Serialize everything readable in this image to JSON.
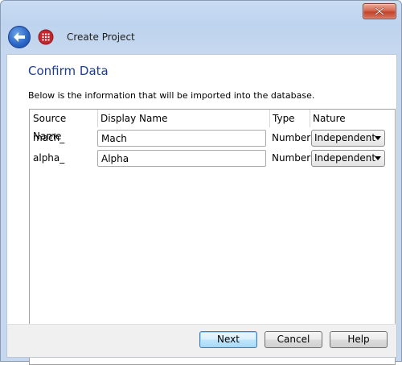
{
  "window": {
    "title": "Create Project"
  },
  "page": {
    "heading": "Confirm Data",
    "description": "Below is the information that will be imported into the database."
  },
  "table": {
    "columns": [
      "Source Name",
      "Display Name",
      "Type",
      "Nature"
    ],
    "rows": [
      {
        "source_name": "mach_",
        "display_name": "Mach",
        "type": "Number",
        "nature": "Independent"
      },
      {
        "source_name": "alpha_",
        "display_name": "Alpha",
        "type": "Number",
        "nature": "Independent"
      }
    ]
  },
  "buttons": {
    "next": "Next",
    "cancel": "Cancel",
    "help": "Help"
  },
  "colors": {
    "heading": "#1f3e8f",
    "chrome": "#c6d8ef",
    "close": "#c2432b"
  }
}
